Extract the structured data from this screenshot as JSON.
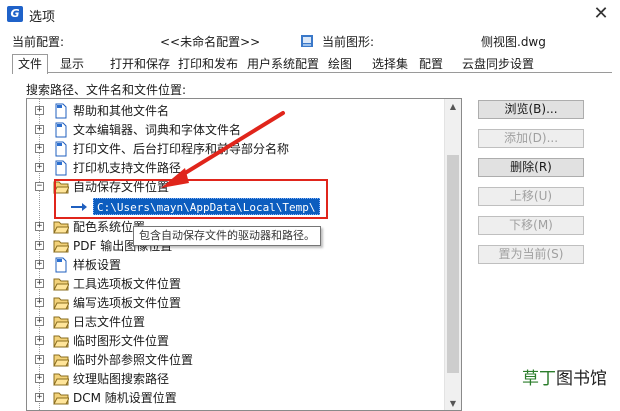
{
  "window": {
    "title": "选项",
    "close_glyph": "✕"
  },
  "config": {
    "current_profile_label": "当前配置:",
    "current_profile_value": "<<未命名配置>>",
    "current_drawing_label": "当前图形:",
    "current_drawing_value": "侧视图.dwg"
  },
  "tabs": [
    "文件",
    "显示",
    "打开和保存",
    "打印和发布",
    "用户系统配置",
    "绘图",
    "选择集",
    "配置",
    "云盘同步设置"
  ],
  "active_tab": "文件",
  "tree": {
    "group_label": "搜索路径、文件名和文件位置:",
    "items_before": [
      "帮助和其他文件名",
      "文本编辑器、词典和字体文件名",
      "打印文件、后台打印程序和前导部分名称",
      "打印机支持文件路径"
    ],
    "expanded_item": "自动保存文件位置",
    "expanded_child": "C:\\Users\\mayn\\AppData\\Local\\Temp\\",
    "items_after": [
      "配色系统位置",
      "PDF 输出图像位置",
      "样板设置",
      "工具选项板文件位置",
      "编写选项板文件位置",
      "日志文件位置",
      "临时图形文件位置",
      "临时外部参照文件位置",
      "纹理贴图搜索路径",
      "DCM 随机设置位置"
    ],
    "tooltip": "包含自动保存文件的驱动器和路径。"
  },
  "buttons": {
    "browse": "浏览(B)...",
    "add": "添加(D)...",
    "delete": "删除(R)",
    "move_up": "上移(U)",
    "move_down": "下移(M)",
    "set_current": "置为当前(S)"
  },
  "watermark": {
    "part1": "草丁",
    "part2": "图书馆"
  },
  "colors": {
    "accent": "#0c5dbf",
    "highlight_box": "#e0251b",
    "app_icon": "#1f62c9"
  }
}
